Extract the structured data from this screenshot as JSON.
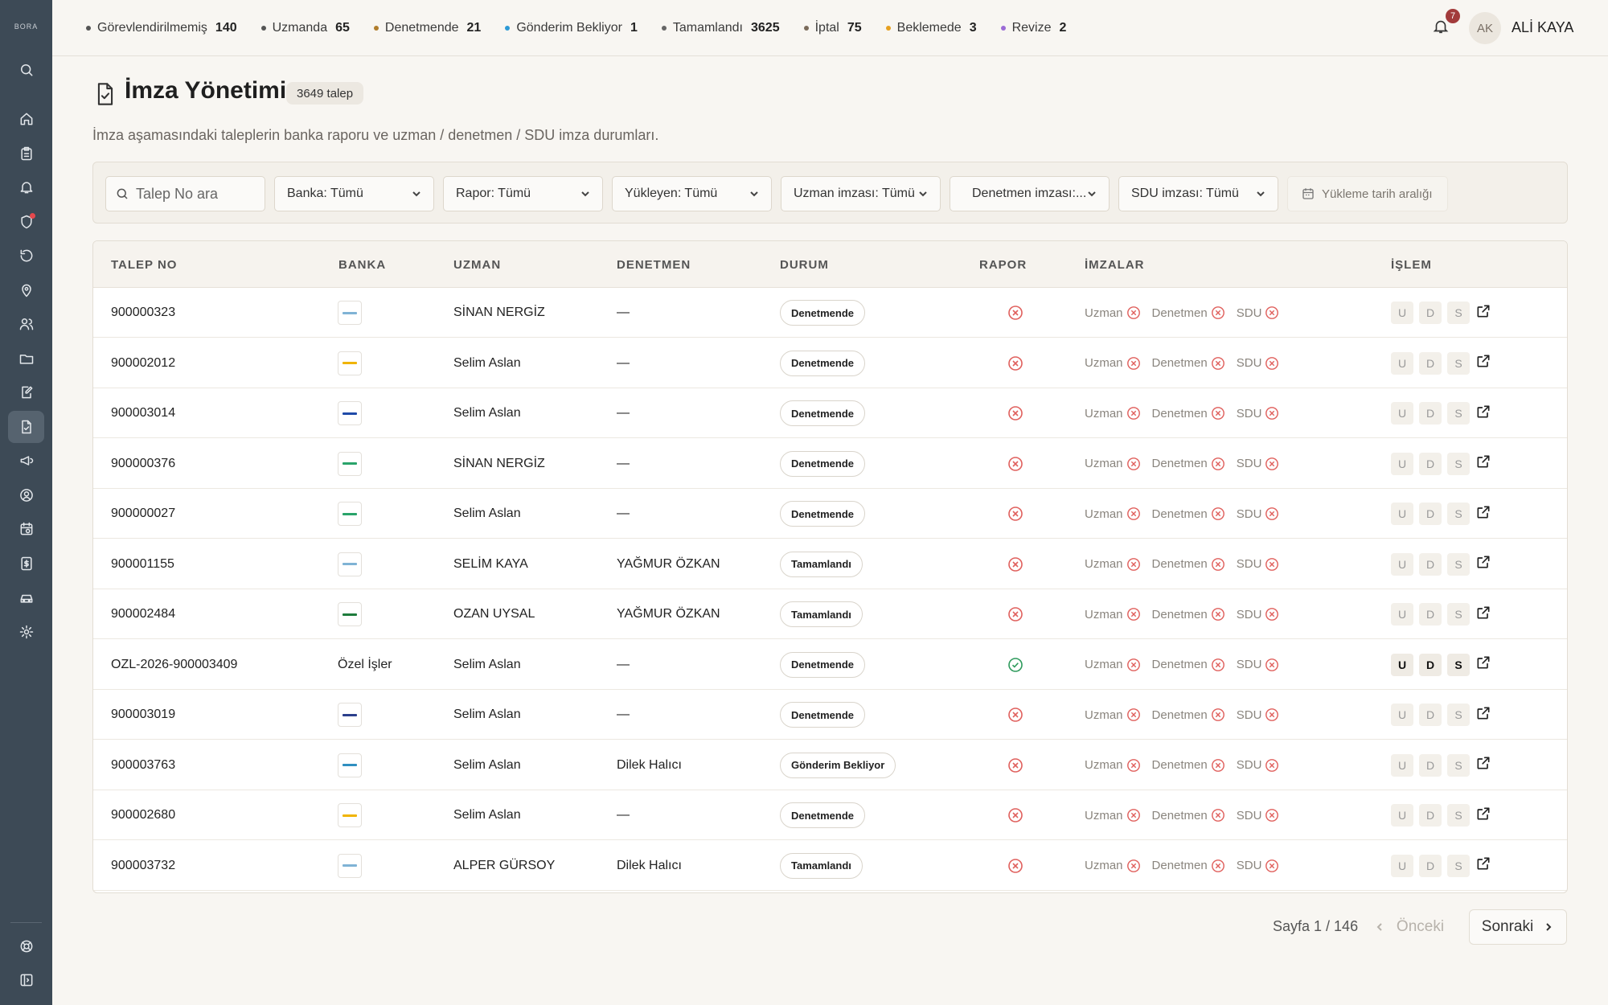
{
  "app": {
    "logo_text": "BORA"
  },
  "topbar": {
    "stats": [
      {
        "label": "Görevlendirilmemiş",
        "count": "140",
        "color": "#555555"
      },
      {
        "label": "Uzmanda",
        "count": "65",
        "color": "#555555"
      },
      {
        "label": "Denetmende",
        "count": "21",
        "color": "#b07d2c"
      },
      {
        "label": "Gönderim Bekliyor",
        "count": "1",
        "color": "#2d9ad6"
      },
      {
        "label": "Tamamlandı",
        "count": "3625",
        "color": "#666666"
      },
      {
        "label": "İptal",
        "count": "75",
        "color": "#7a6a5a"
      },
      {
        "label": "Beklemede",
        "count": "3",
        "color": "#e6a020"
      },
      {
        "label": "Revize",
        "count": "2",
        "color": "#9b6bd6"
      }
    ],
    "notification_count": "7",
    "user_initials": "AK",
    "user_name": "ALİ KAYA"
  },
  "header": {
    "title": "İmza Yönetimi",
    "count_badge": "3649 talep",
    "subtitle": "İmza aşamasındaki taleplerin banka raporu ve uzman / denetmen / SDU imza durumları."
  },
  "filters": {
    "search_placeholder": "Talep No ara",
    "bank": "Banka: Tümü",
    "report": "Rapor: Tümü",
    "uploader": "Yükleyen: Tümü",
    "expert_sig": "Uzman imzası: Tümü",
    "auditor_sig": "Denetmen imzası:...",
    "sdu_sig": "SDU imzası: Tümü",
    "date_range": "Yükleme tarih aralığı"
  },
  "table": {
    "columns": [
      "TALEP NO",
      "BANKA",
      "UZMAN",
      "DENETMEN",
      "DURUM",
      "RAPOR",
      "İMZALAR",
      "İŞLEM"
    ],
    "sig_labels": {
      "u": "Uzman",
      "d": "Denetmen",
      "s": "SDU"
    },
    "action_labels": {
      "u": "U",
      "d": "D",
      "s": "S"
    },
    "rows": [
      {
        "talep_no": "900000323",
        "bank_text": "",
        "bank_color": "#7fb3d5",
        "uzman": "SİNAN NERGİZ",
        "denetmen": "—",
        "durum": "Denetmende",
        "rapor": "missing"
      },
      {
        "talep_no": "900002012",
        "bank_text": "",
        "bank_color": "#f0b400",
        "uzman": "Selim Aslan",
        "denetmen": "—",
        "durum": "Denetmende",
        "rapor": "missing"
      },
      {
        "talep_no": "900003014",
        "bank_text": "",
        "bank_color": "#1f4aa8",
        "uzman": "Selim Aslan",
        "denetmen": "—",
        "durum": "Denetmende",
        "rapor": "missing"
      },
      {
        "talep_no": "900000376",
        "bank_text": "",
        "bank_color": "#29a36a",
        "uzman": "SİNAN NERGİZ",
        "denetmen": "—",
        "durum": "Denetmende",
        "rapor": "missing"
      },
      {
        "talep_no": "900000027",
        "bank_text": "",
        "bank_color": "#29a36a",
        "uzman": "Selim Aslan",
        "denetmen": "—",
        "durum": "Denetmende",
        "rapor": "missing"
      },
      {
        "talep_no": "900001155",
        "bank_text": "",
        "bank_color": "#7fb3d5",
        "uzman": "SELİM KAYA",
        "denetmen": "YAĞMUR ÖZKAN",
        "durum": "Tamamlandı",
        "rapor": "missing"
      },
      {
        "talep_no": "900002484",
        "bank_text": "",
        "bank_color": "#1e7b3c",
        "uzman": "OZAN UYSAL",
        "denetmen": "YAĞMUR ÖZKAN",
        "durum": "Tamamlandı",
        "rapor": "missing"
      },
      {
        "talep_no": "OZL-2026-900003409",
        "bank_text": "Özel İşler",
        "bank_color": "",
        "uzman": "Selim Aslan",
        "denetmen": "—",
        "durum": "Denetmende",
        "rapor": "ok"
      },
      {
        "talep_no": "900003019",
        "bank_text": "",
        "bank_color": "#2b3f8c",
        "uzman": "Selim Aslan",
        "denetmen": "—",
        "durum": "Denetmende",
        "rapor": "missing"
      },
      {
        "talep_no": "900003763",
        "bank_text": "",
        "bank_color": "#2f8fc0",
        "uzman": "Selim Aslan",
        "denetmen": "Dilek Halıcı",
        "durum": "Gönderim Bekliyor",
        "rapor": "missing"
      },
      {
        "talep_no": "900002680",
        "bank_text": "",
        "bank_color": "#f0b400",
        "uzman": "Selim Aslan",
        "denetmen": "—",
        "durum": "Denetmende",
        "rapor": "missing"
      },
      {
        "talep_no": "900003732",
        "bank_text": "",
        "bank_color": "#7fb3d5",
        "uzman": "ALPER GÜRSOY",
        "denetmen": "Dilek Halıcı",
        "durum": "Tamamlandı",
        "rapor": "missing"
      }
    ]
  },
  "pagination": {
    "info": "Sayfa 1 / 146",
    "prev": "Önceki",
    "next": "Sonraki"
  }
}
